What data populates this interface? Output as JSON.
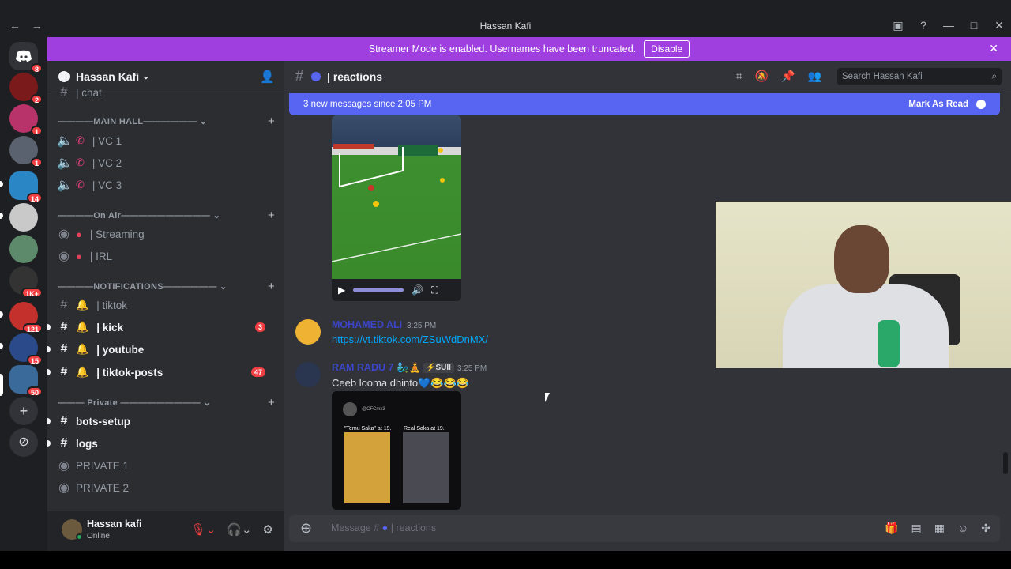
{
  "window": {
    "title": "Hassan Kafi"
  },
  "banner": {
    "text": "Streamer Mode is enabled. Usernames have been truncated.",
    "button": "Disable"
  },
  "rail": {
    "badges": [
      "8",
      "2",
      "1",
      "1",
      "14",
      "1K+",
      "121",
      "15",
      "50"
    ]
  },
  "guild": {
    "name": "Hassan Kafi"
  },
  "sidebar": {
    "partial_channel": "| chat",
    "categories": [
      {
        "label": "————MAIN HALL——————"
      },
      {
        "label": "————On Air——————————"
      },
      {
        "label": "————NOTIFICATIONS——————"
      },
      {
        "label": "——— Private —————————"
      }
    ],
    "voice_channels": [
      "| VC 1",
      "| VC 2",
      "| VC 3"
    ],
    "onair_channels": [
      "| Streaming",
      "| IRL"
    ],
    "notification_channels": [
      {
        "label": "| tiktok",
        "count": ""
      },
      {
        "label": "| kick",
        "count": "3"
      },
      {
        "label": "| youtube",
        "count": ""
      },
      {
        "label": "| tiktok-posts",
        "count": "47"
      }
    ],
    "private_channels": [
      "bots-setup",
      "logs",
      "PRIVATE 1",
      "PRIVATE 2"
    ]
  },
  "user_panel": {
    "name": "Hassan kafi",
    "status": "Online"
  },
  "chat": {
    "channel": "| reactions",
    "search_placeholder": "Search Hassan Kafi",
    "new_messages": "3 new messages since 2:05 PM",
    "mark_as_read": "Mark As Read",
    "messages": [
      {
        "author": "MOHAMED ALI",
        "time": "3:25 PM",
        "text": "https://vt.tiktok.com/ZSuWdDnMX/"
      },
      {
        "author": "RAM RADU 7 🧞‍♂️🧘",
        "tag": "⚡SUII",
        "time": "3:25 PM",
        "text": "Ceeb looma dhinto💙😂😂😂"
      }
    ],
    "media_caption_left": "\"Temu Saka\" at 19.",
    "media_caption_right": "Real Saka at 19.",
    "media_handle": "@CFCmx3",
    "composer_placeholder": "Message #",
    "composer_channel": "| reactions"
  },
  "colors": {
    "accent": "#5865f2",
    "streamer": "#a03fe0",
    "danger": "#f23f43",
    "link": "#00a8fc"
  }
}
